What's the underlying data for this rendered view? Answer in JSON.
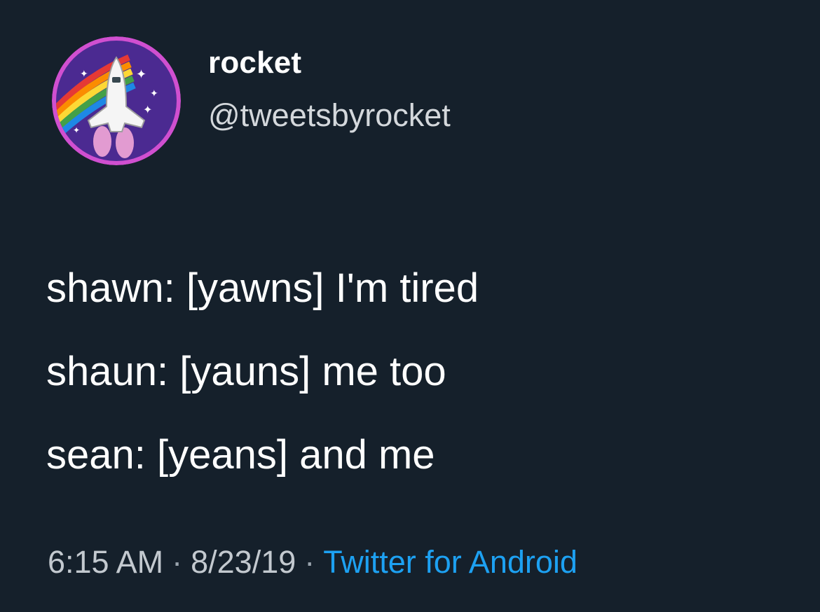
{
  "tweet": {
    "display_name": "rocket",
    "handle": "@tweetsbyrocket",
    "avatar_icon": "rocket-shuttle-rainbow-avatar",
    "lines": [
      "shawn: [yawns] I'm tired",
      "shaun: [yauns] me too",
      "sean: [yeans] and me"
    ],
    "time": "6:15 AM",
    "date": "8/23/19",
    "separator": "·",
    "source": "Twitter for Android"
  },
  "colors": {
    "background": "#15202b",
    "text": "#ffffff",
    "secondary_text": "#c3c9cf",
    "link": "#1da1f2",
    "avatar_ring": "#d04fd0",
    "avatar_bg": "#4b2a91"
  }
}
